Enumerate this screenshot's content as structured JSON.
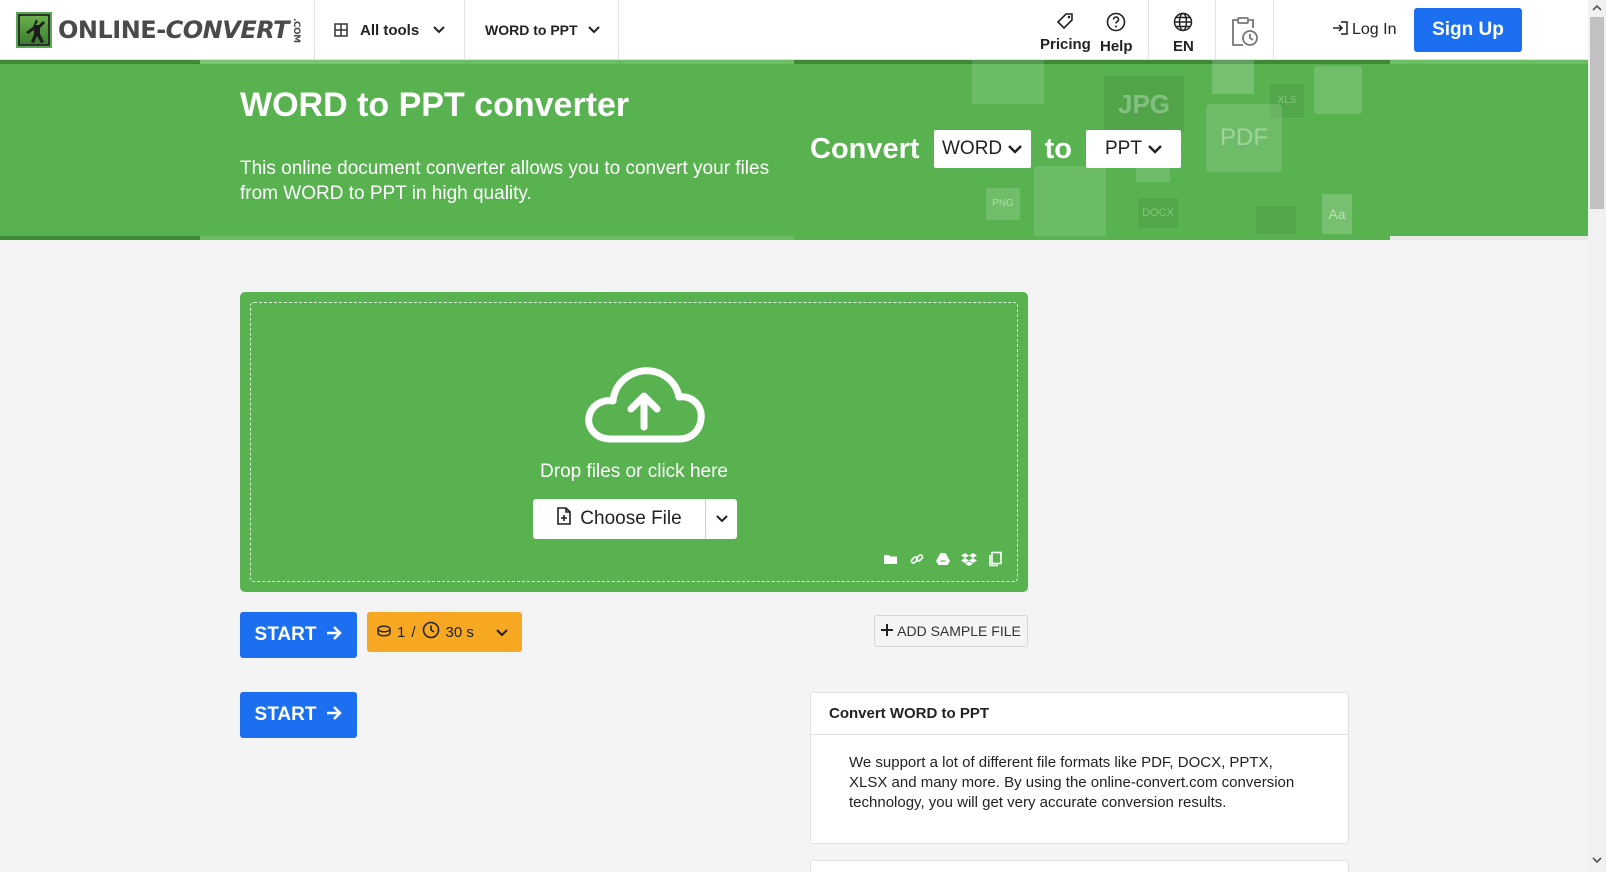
{
  "header": {
    "logo_text_a": "ONLINE-",
    "logo_text_b": "CONVERT",
    "logo_text_com": ".COM",
    "all_tools_label": "All tools",
    "current_tool_label": "WORD to PPT",
    "pricing_label": "Pricing",
    "help_label": "Help",
    "language_label": "EN",
    "login_label": "Log In",
    "signup_label": "Sign Up"
  },
  "hero": {
    "title": "WORD to PPT converter",
    "description": "This online document converter allows you to convert your files from WORD to PPT in high quality.",
    "convert_label": "Convert",
    "from_format": "WORD",
    "to_label": "to",
    "to_format": "PPT",
    "deco_labels": [
      "JPG",
      "PDF",
      "PNG",
      "DOCX",
      "XLS",
      "Aa"
    ]
  },
  "upload": {
    "drop_text": "Drop files or click here",
    "choose_file_label": "Choose File"
  },
  "actions": {
    "start_label": "START",
    "credits_count": "1",
    "credits_separator": "/",
    "time_label": "30 s",
    "add_sample_label": "ADD SAMPLE FILE"
  },
  "info_box": {
    "title": "Convert WORD to PPT",
    "body": "We support a lot of different file formats like PDF, DOCX, PPTX, XLSX and many more. By using the online-convert.com conversion technology, you will get very accurate conversion results."
  },
  "colors": {
    "brand_green": "#58b250",
    "primary_blue": "#1d6ff2",
    "credits_orange": "#f7a823"
  }
}
